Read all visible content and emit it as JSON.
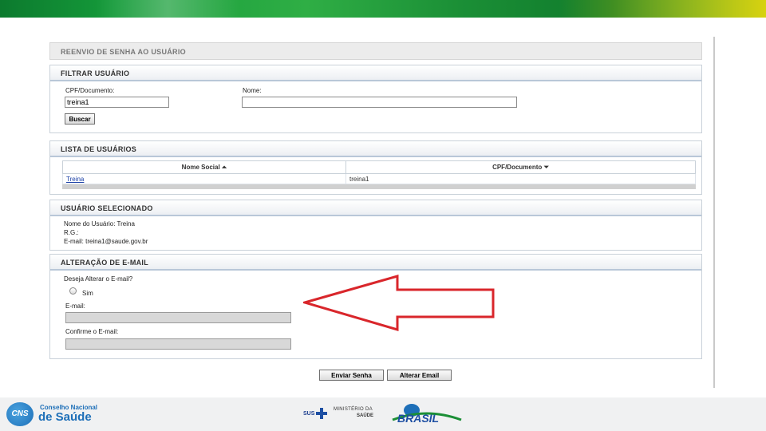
{
  "page": {
    "title": "REENVIO DE SENHA AO USUÁRIO"
  },
  "filter": {
    "heading": "FILTRAR USUÁRIO",
    "cpf_label": "CPF/Documento:",
    "cpf_value": "treina1",
    "name_label": "Nome:",
    "name_value": "",
    "search_button": "Buscar"
  },
  "user_list": {
    "heading": "LISTA DE USUÁRIOS",
    "columns": [
      "Nome Social ⏶",
      "CPF/Documento ⏷"
    ],
    "rows": [
      {
        "name": "Treina",
        "document": "treina1"
      }
    ]
  },
  "selected_user": {
    "heading": "USUÁRIO SELECIONADO",
    "name_line": "Nome do Usuário: Treina",
    "rg_line": "R.G.:",
    "email_line": "E-mail: treina1@saude.gov.br"
  },
  "email_change": {
    "heading": "ALTERAÇÃO DE E-MAIL",
    "question": "Deseja Alterar o E-mail?",
    "option_yes": "Sim",
    "email_label": "E-mail:",
    "email_value": "",
    "confirm_label": "Confirme o E-mail:",
    "confirm_value": ""
  },
  "actions": {
    "send_password": "Enviar Senha",
    "change_email": "Alterar Email"
  },
  "footer": {
    "cns_badge": "CNS",
    "cns_line1": "Conselho Nacional",
    "cns_line2": "de Saúde",
    "sus": "SUS",
    "ministry_line1": "MINISTÉRIO DA",
    "ministry_line2": "SAÚDE",
    "brasil_text": "BRASIL"
  },
  "colors": {
    "arrow": "#d9262b",
    "link": "#1a3fa6",
    "header_border": "#b9c7d8"
  }
}
